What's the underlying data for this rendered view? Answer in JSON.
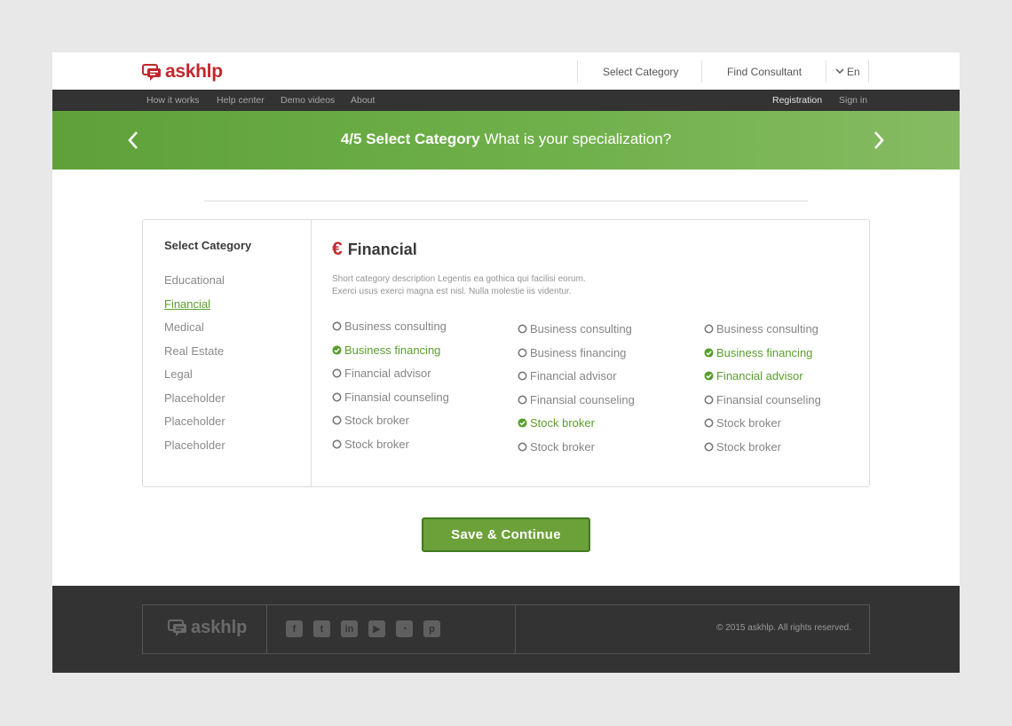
{
  "brand": {
    "name": "askhlp",
    "color": "#c1272d"
  },
  "header": {
    "select_category": "Select Category",
    "find_consultant": "Find Consultant",
    "language": "En"
  },
  "subnav": {
    "items": [
      "How it works",
      "Help center",
      "Demo videos",
      "About"
    ],
    "registration": "Registration",
    "sign_in": "Sign in"
  },
  "banner": {
    "step": "4/5 Select Category",
    "question": "What is your specialization?"
  },
  "sidebar": {
    "title": "Select Category",
    "items": [
      "Educational",
      "Financial",
      "Medical",
      "Real Estate",
      "Legal",
      "Placeholder",
      "Placeholder",
      "Placeholder"
    ],
    "active": "Financial"
  },
  "category": {
    "icon": "€",
    "name": "Financial",
    "description_line1": "Short category description Legentis ea gothica qui facilisi eorum.",
    "description_line2": "Exerci usus exerci magna est nisl. Nulla molestie iis videntur.",
    "columns": [
      [
        {
          "label": "Business consulting",
          "checked": false
        },
        {
          "label": "Business financing",
          "checked": true
        },
        {
          "label": "Financial advisor",
          "checked": false
        },
        {
          "label": "Finansial counseling",
          "checked": false
        },
        {
          "label": "Stock broker",
          "checked": false
        },
        {
          "label": "Stock broker",
          "checked": false
        }
      ],
      [
        {
          "label": "Business consulting",
          "checked": false
        },
        {
          "label": "Business financing",
          "checked": false
        },
        {
          "label": "Financial advisor",
          "checked": false
        },
        {
          "label": "Finansial counseling",
          "checked": false
        },
        {
          "label": "Stock broker",
          "checked": true
        },
        {
          "label": "Stock broker",
          "checked": false
        }
      ],
      [
        {
          "label": "Business consulting",
          "checked": false
        },
        {
          "label": "Business financing",
          "checked": true
        },
        {
          "label": "Financial advisor",
          "checked": true
        },
        {
          "label": "Finansial counseling",
          "checked": false
        },
        {
          "label": "Stock broker",
          "checked": false
        },
        {
          "label": "Stock broker",
          "checked": false
        }
      ]
    ]
  },
  "actions": {
    "save": "Save & Continue"
  },
  "footer": {
    "logo": "askhlp",
    "social_icons": [
      "facebook-icon",
      "twitter-icon",
      "linkedin-icon",
      "youtube-icon",
      "rss-icon",
      "pinterest-icon"
    ],
    "copyright": "2015 askhlp. All rights reserved."
  },
  "colors": {
    "accent_green": "#6ca13a",
    "dark": "#333333",
    "brand_red": "#c1272d"
  }
}
